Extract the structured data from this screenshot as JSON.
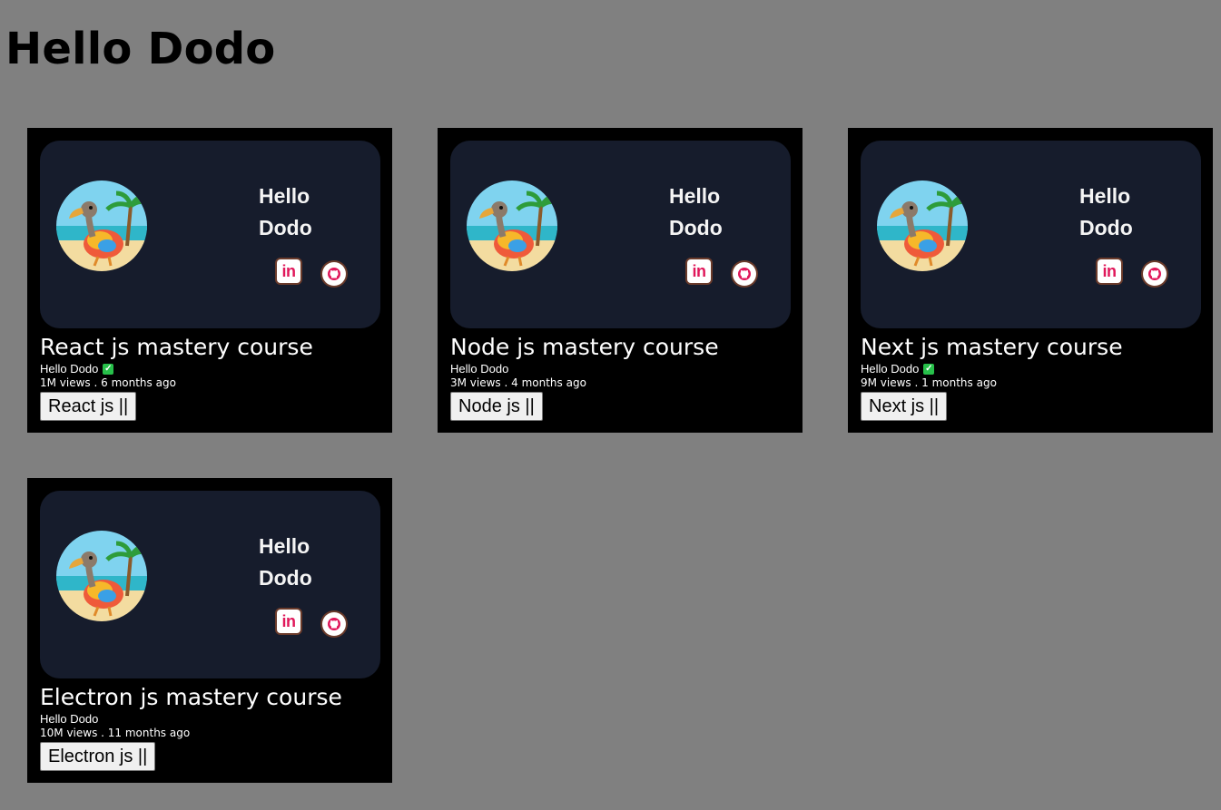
{
  "page": {
    "title": "Hello Dodo"
  },
  "cards": [
    {
      "thumbnail_name_line1": "Hello",
      "thumbnail_name_line2": "Dodo",
      "title": "React js mastery course",
      "channel": "Hello Dodo",
      "verified": true,
      "meta": "1M views . 6 months ago",
      "button_label": "React js ||"
    },
    {
      "thumbnail_name_line1": "Hello",
      "thumbnail_name_line2": "Dodo",
      "title": "Node js mastery course",
      "channel": "Hello Dodo",
      "verified": false,
      "meta": "3M views . 4 months ago",
      "button_label": "Node js ||"
    },
    {
      "thumbnail_name_line1": "Hello",
      "thumbnail_name_line2": "Dodo",
      "title": "Next js mastery course",
      "channel": "Hello Dodo",
      "verified": true,
      "meta": "9M views . 1 months ago",
      "button_label": "Next js ||"
    },
    {
      "thumbnail_name_line1": "Hello",
      "thumbnail_name_line2": "Dodo",
      "title": "Electron js mastery course",
      "channel": "Hello Dodo",
      "verified": false,
      "meta": "10M views . 11 months ago",
      "button_label": "Electron js ||"
    }
  ],
  "icons": {
    "avatar": "dodo-avatar-icon",
    "linkedin": "linkedin-icon",
    "linkedin_glyph": "in",
    "github": "github-icon",
    "verified": "verified-check-icon",
    "verified_glyph": "✓"
  },
  "colors": {
    "page_background": "#808080",
    "card_background": "#000000",
    "thumbnail_background": "#161c2c",
    "accent_pink": "#e0175a",
    "verified_green": "#27c04a"
  }
}
